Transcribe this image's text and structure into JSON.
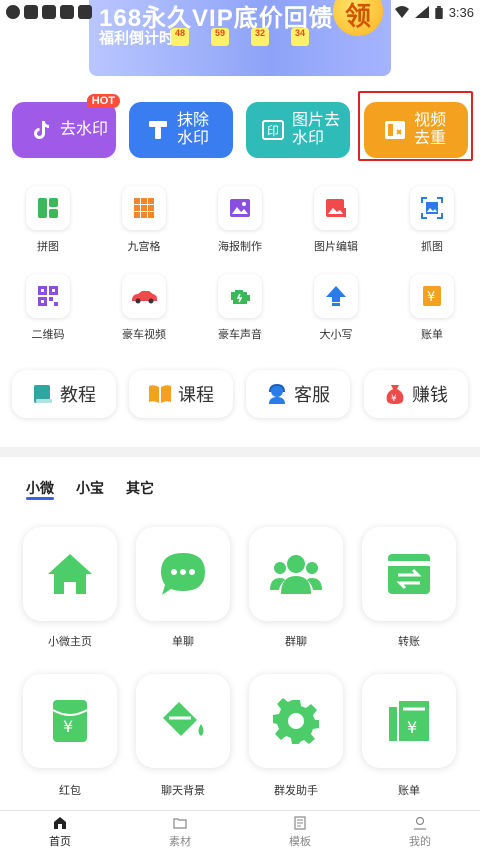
{
  "status_bar": {
    "time": "3:36"
  },
  "banner": {
    "title": "168永久VIP底价回馈",
    "subtitle": "福利倒计时",
    "countdown": [
      "48",
      "59",
      "32",
      "34"
    ],
    "coin_label": "领"
  },
  "main_tools": [
    {
      "label": "去水印",
      "icon": "tiktok-icon",
      "badge": "HOT",
      "color": "#a05ae8"
    },
    {
      "label": "抹除\n水印",
      "icon": "eraser-icon",
      "color": "#3a7df0"
    },
    {
      "label": "图片去\n水印",
      "icon": "image-stamp-icon",
      "color": "#2fbcb8"
    },
    {
      "label": "视频\n去重",
      "icon": "video-dedupe-icon",
      "color": "#f5a120"
    }
  ],
  "grid_row1": [
    {
      "label": "拼图",
      "icon": "puzzle-icon"
    },
    {
      "label": "九宫格",
      "icon": "grid9-icon"
    },
    {
      "label": "海报制作",
      "icon": "poster-icon"
    },
    {
      "label": "图片编辑",
      "icon": "image-edit-icon"
    },
    {
      "label": "抓图",
      "icon": "capture-icon"
    }
  ],
  "grid_row2": [
    {
      "label": "二维码",
      "icon": "qrcode-icon"
    },
    {
      "label": "豪车视频",
      "icon": "car-icon"
    },
    {
      "label": "豪车声音",
      "icon": "engine-icon"
    },
    {
      "label": "大小写",
      "icon": "upper-arrow-icon"
    },
    {
      "label": "账单",
      "icon": "yen-bill-icon"
    }
  ],
  "pills": [
    {
      "label": "教程",
      "icon": "book-icon"
    },
    {
      "label": "课程",
      "icon": "open-book-icon"
    },
    {
      "label": "客服",
      "icon": "headset-icon"
    },
    {
      "label": "赚钱",
      "icon": "money-bag-icon"
    }
  ],
  "tabs": [
    "小微",
    "小宝",
    "其它"
  ],
  "cards_row1": [
    {
      "label": "小微主页",
      "icon": "home-icon"
    },
    {
      "label": "单聊",
      "icon": "chat-icon"
    },
    {
      "label": "群聊",
      "icon": "group-icon"
    },
    {
      "label": "转账",
      "icon": "transfer-icon"
    }
  ],
  "cards_row2": [
    {
      "label": "红包",
      "icon": "red-envelope-icon"
    },
    {
      "label": "聊天背景",
      "icon": "paint-bucket-icon"
    },
    {
      "label": "群发助手",
      "icon": "gear-icon"
    },
    {
      "label": "账单",
      "icon": "bill-icon"
    }
  ],
  "bottom_nav": [
    {
      "label": "首页",
      "icon": "home-nav-icon"
    },
    {
      "label": "素材",
      "icon": "folder-icon"
    },
    {
      "label": "模板",
      "icon": "template-icon"
    },
    {
      "label": "我的",
      "icon": "user-icon"
    }
  ],
  "accent_green": "#4ccd6a"
}
